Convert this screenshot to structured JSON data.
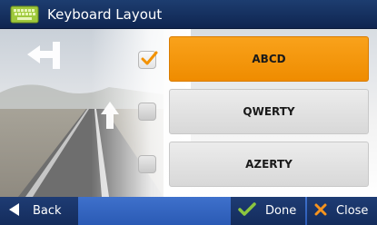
{
  "header": {
    "title": "Keyboard Layout",
    "icon": "keyboard-icon"
  },
  "options": [
    {
      "label": "ABCD",
      "checked": true
    },
    {
      "label": "QWERTY",
      "checked": false
    },
    {
      "label": "AZERTY",
      "checked": false
    }
  ],
  "footer": {
    "back_label": "Back",
    "done_label": "Done",
    "close_label": "Close"
  },
  "colors": {
    "accent": "#f39200",
    "header_bg": "#15305f",
    "footer_bg": "#2f63c0",
    "done_check": "#8cc63f",
    "close_x": "#f7941d"
  }
}
